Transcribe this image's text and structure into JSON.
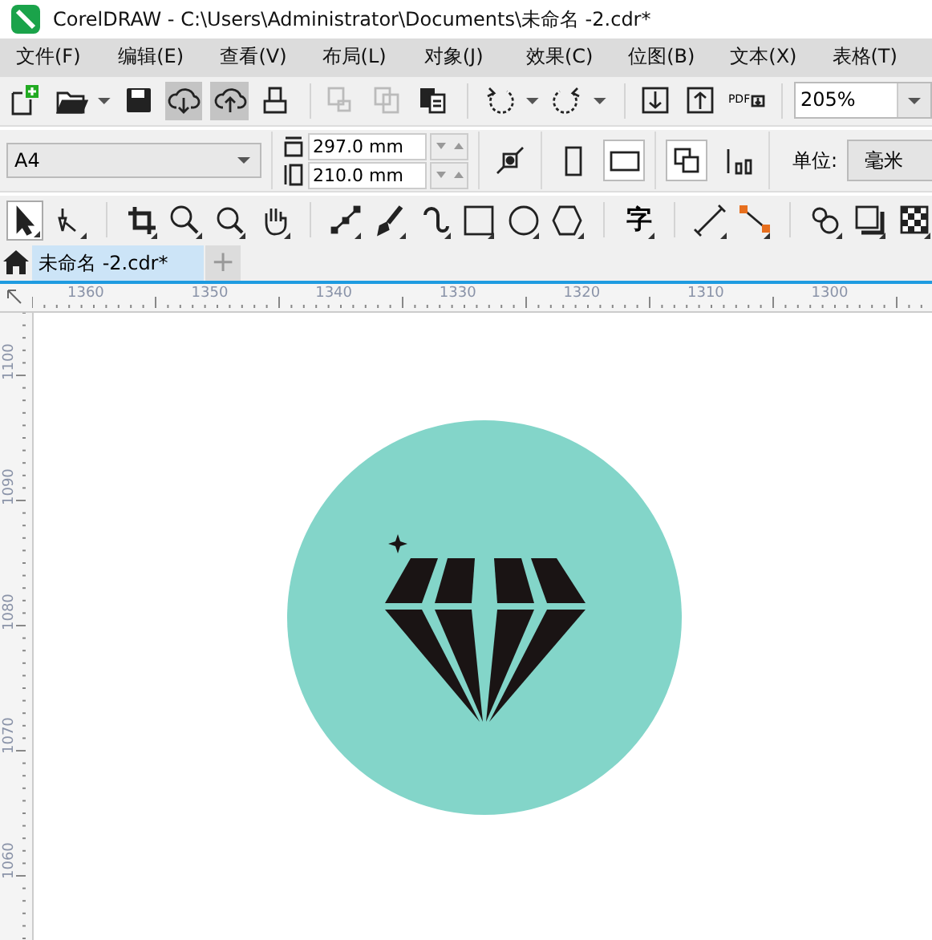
{
  "window": {
    "title": "CorelDRAW - C:\\Users\\Administrator\\Documents\\未命名 -2.cdr*"
  },
  "menu": [
    "文件(F)",
    "编辑(E)",
    "查看(V)",
    "布局(L)",
    "对象(J)",
    "效果(C)",
    "位图(B)",
    "文本(X)",
    "表格(T)"
  ],
  "toolbar": {
    "buttons": [
      {
        "pressed": false
      },
      {
        "pressed": false
      },
      {
        "pressed": false
      },
      {
        "pressed": true
      },
      {
        "pressed": true
      },
      {
        "pressed": false
      },
      {
        "pressed": false
      },
      {
        "pressed": false
      },
      {
        "pressed": false
      },
      {
        "pressed": false
      },
      {
        "pressed": false
      },
      {
        "pressed": false
      },
      {
        "pressed": false
      },
      {
        "pressed": false
      }
    ],
    "pdf_label": "PDF",
    "zoom": "205%"
  },
  "property_bar": {
    "page_size": "A4",
    "width": "297.0 mm",
    "height": "210.0 mm",
    "orientation": [
      {
        "selected": false
      },
      {
        "selected": true
      }
    ],
    "page_mode": [
      {
        "selected": true
      },
      {
        "selected": false
      }
    ],
    "unit_label": "单位:",
    "unit": "毫米"
  },
  "toolbox": {
    "tools": [
      {
        "selected": true
      },
      {
        "selected": false
      },
      {
        "selected": false
      },
      {
        "selected": false
      },
      {
        "selected": false
      },
      {
        "selected": false
      },
      {
        "selected": false
      },
      {
        "selected": false
      },
      {
        "selected": false
      },
      {
        "selected": false
      },
      {
        "selected": false
      },
      {
        "selected": false
      },
      {
        "selected": false
      },
      {
        "selected": false
      },
      {
        "selected": false
      },
      {
        "selected": false
      },
      {
        "selected": false
      },
      {
        "selected": false
      }
    ],
    "text_tool": "字"
  },
  "tabs": [
    {
      "label": "未命名 -2.cdr*",
      "selected": true
    }
  ],
  "new_tab": "+",
  "rulers": {
    "horizontal": [
      "1360",
      "1350",
      "1340",
      "1330",
      "1320",
      "1310",
      "1300"
    ],
    "vertical": [
      "1100",
      "1090",
      "1080",
      "1070",
      "1060"
    ]
  }
}
